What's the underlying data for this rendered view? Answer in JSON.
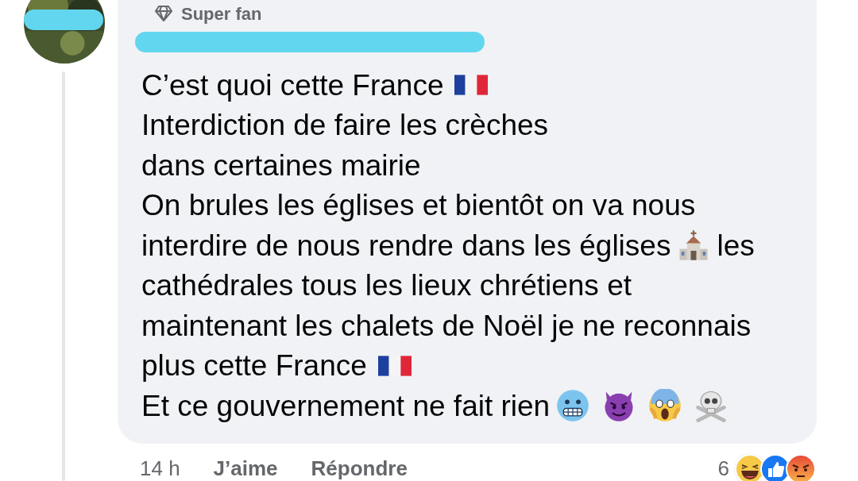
{
  "comment": {
    "badge": "Super fan",
    "lines": [
      [
        {
          "kind": "text",
          "text": "C’est quoi cette France"
        },
        {
          "kind": "flag"
        }
      ],
      [
        {
          "kind": "text",
          "text": "Interdiction de faire les crèches"
        }
      ],
      [
        {
          "kind": "text",
          "text": "dans certaines mairie"
        }
      ],
      [
        {
          "kind": "text",
          "text": "On brules les églises et bientôt on va nous"
        }
      ],
      [
        {
          "kind": "text",
          "text": "interdire de nous rendre dans les églises"
        },
        {
          "kind": "church"
        },
        {
          "kind": "text",
          "text": "les"
        }
      ],
      [
        {
          "kind": "text",
          "text": "cathédrales tous les lieux chrétiens et"
        }
      ],
      [
        {
          "kind": "text",
          "text": "maintenant les chalets de Noël je ne reconnais"
        }
      ],
      [
        {
          "kind": "text",
          "text": "plus cette France"
        },
        {
          "kind": "flag"
        }
      ],
      [
        {
          "kind": "text",
          "text": "Et ce gouvernement ne fait rien"
        },
        {
          "kind": "cold"
        },
        {
          "kind": "devil"
        },
        {
          "kind": "scream"
        },
        {
          "kind": "skull"
        }
      ]
    ],
    "time": "14 h",
    "actions": [
      "J’aime",
      "Répondre"
    ],
    "reaction_count": "6",
    "reactions": [
      {
        "kind": "haha"
      },
      {
        "kind": "like"
      },
      {
        "kind": "angry"
      }
    ]
  }
}
